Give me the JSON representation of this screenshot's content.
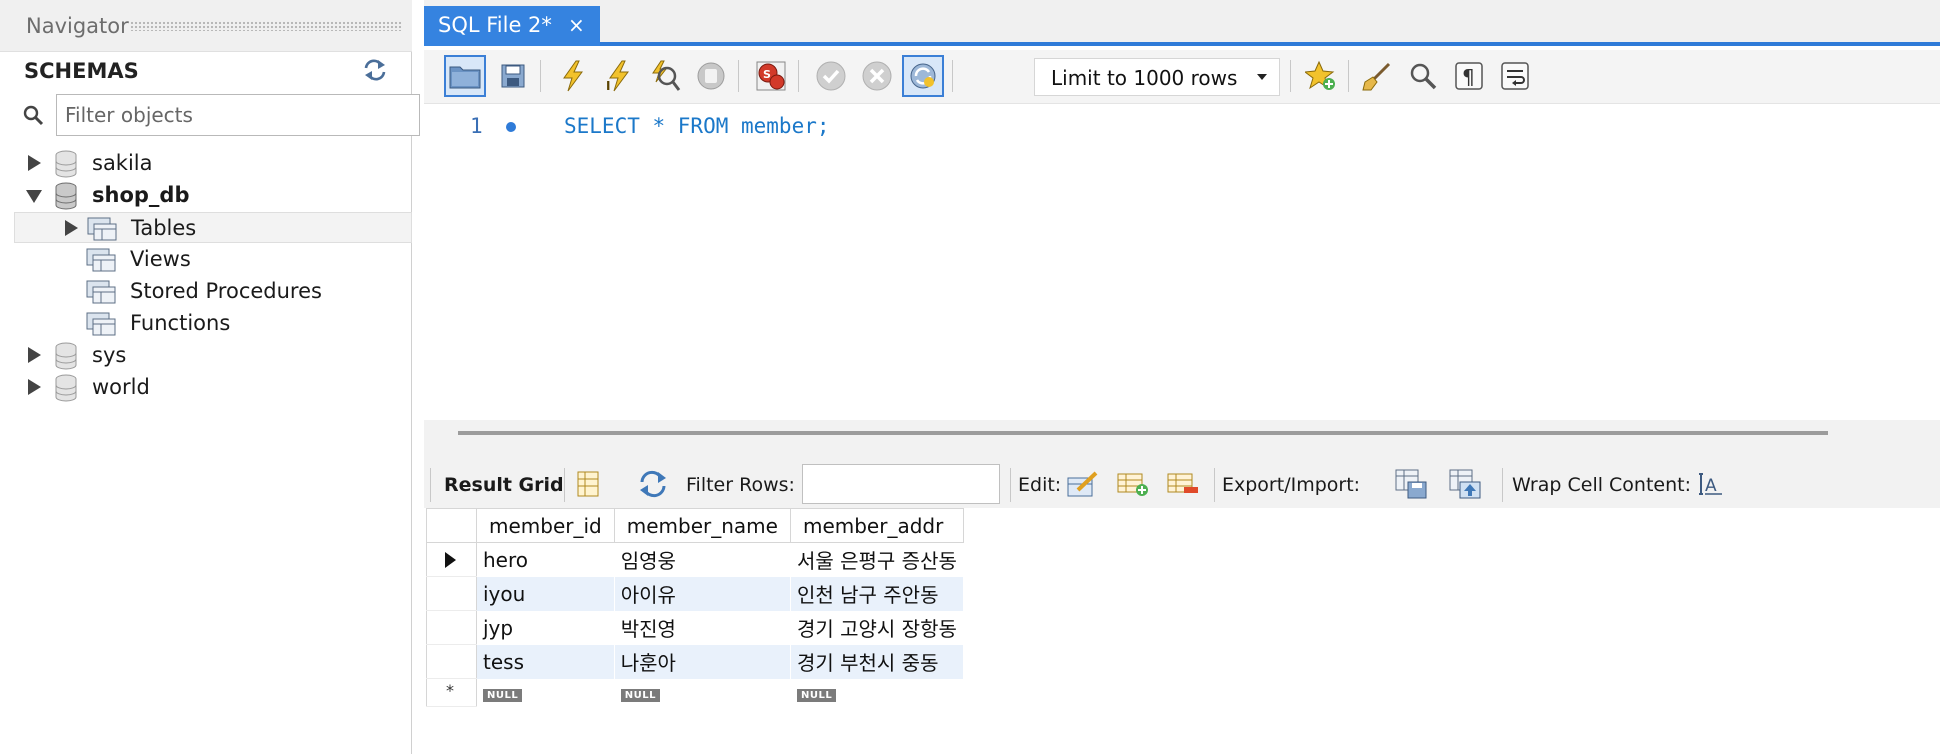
{
  "navigator": {
    "title": "Navigator",
    "schemas_label": "SCHEMAS",
    "filter_placeholder": "Filter objects",
    "tree": {
      "sakila": "sakila",
      "shop_db": "shop_db",
      "tables": "Tables",
      "views": "Views",
      "stored_procedures": "Stored Procedures",
      "functions": "Functions",
      "sys": "sys",
      "world": "world"
    }
  },
  "editor": {
    "tab_label": "SQL File 2*",
    "tab_close": "×",
    "limit_select": "Limit to 1000 rows",
    "line_number": "1",
    "sql": "SELECT * FROM member;"
  },
  "result_toolbar": {
    "result_grid": "Result Grid",
    "filter_rows": "Filter Rows:",
    "edit": "Edit:",
    "export_import": "Export/Import:",
    "wrap_cell_content": "Wrap Cell Content:"
  },
  "result_grid": {
    "columns": [
      "member_id",
      "member_name",
      "member_addr"
    ],
    "rows": [
      [
        "hero",
        "임영웅",
        "서울 은평구 증산동"
      ],
      [
        "iyou",
        "아이유",
        "인천 남구 주안동"
      ],
      [
        "jyp",
        "박진영",
        "경기 고양시 장항동"
      ],
      [
        "tess",
        "나훈아",
        "경기 부천시 중동"
      ]
    ],
    "null_label": "NULL",
    "new_row_marker": "*"
  },
  "colors": {
    "accent": "#2f7bd8",
    "tab_active": "#3583e0",
    "sql_keyword": "#1b78c9",
    "alt_row": "#e9f1fb"
  },
  "icons": {
    "navigator": [
      "refresh-icon",
      "search-icon",
      "database-icon",
      "folder-icon"
    ],
    "toolbar": [
      "open-folder-icon",
      "save-icon",
      "execute-icon",
      "execute-current-icon",
      "explain-icon",
      "stop-icon",
      "toggle-error-stop-icon",
      "commit-icon",
      "rollback-icon",
      "autocommit-icon",
      "bookmark-icon",
      "beautify-icon",
      "find-icon",
      "invisible-chars-icon",
      "word-wrap-icon"
    ],
    "result": [
      "grid-layout-icon",
      "refresh-results-icon",
      "edit-row-icon",
      "insert-row-icon",
      "delete-row-icon",
      "export-icon",
      "import-icon",
      "wrap-text-icon"
    ]
  }
}
